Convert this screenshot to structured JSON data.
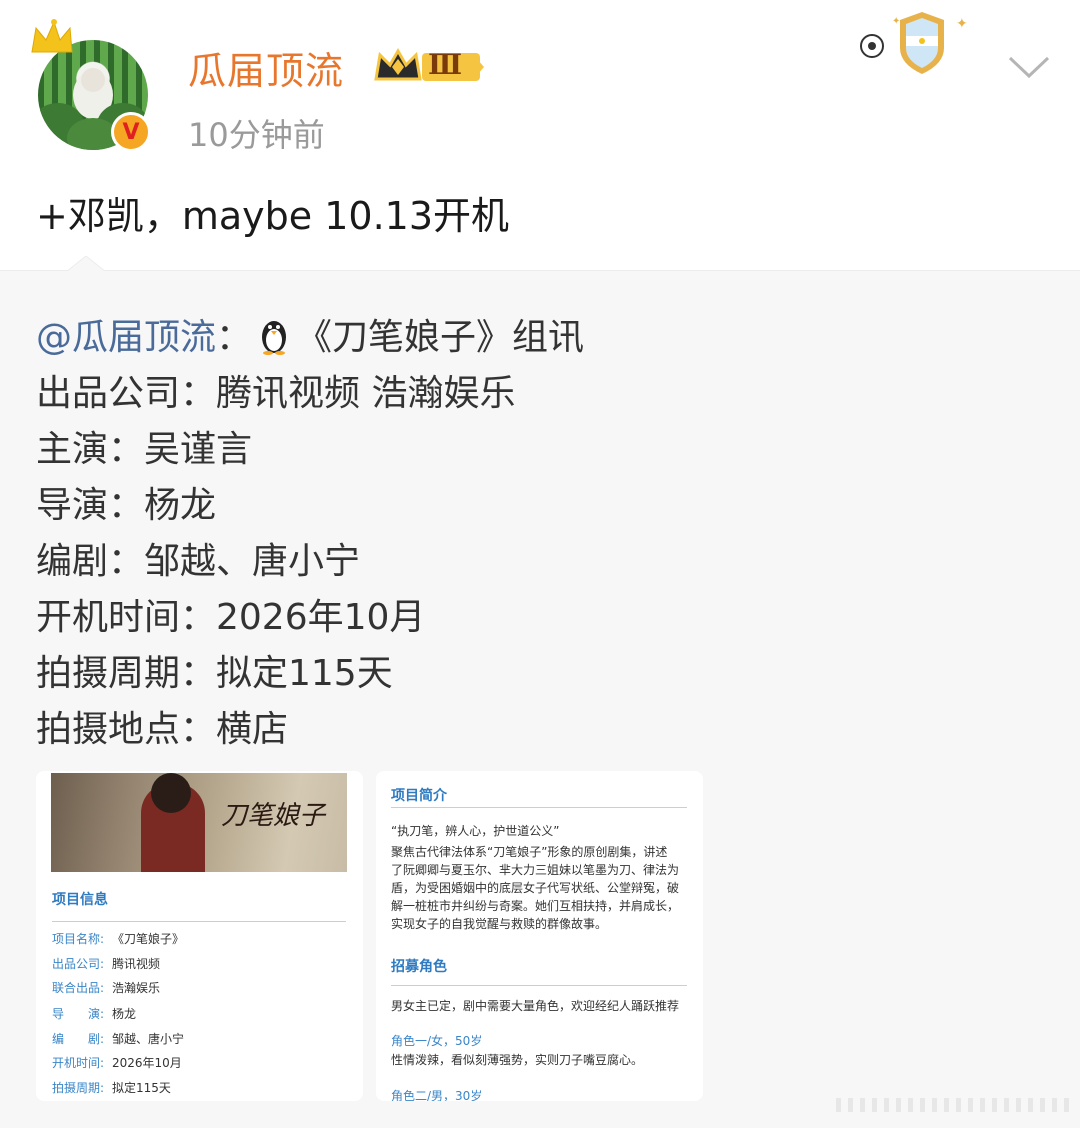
{
  "post": {
    "username": "瓜届顶流",
    "level_badge": "Ⅲ",
    "time": "10分钟前",
    "verified_mark": "V",
    "text": "+邓凯，maybe 10.13开机"
  },
  "repost": {
    "mention": "@瓜届顶流",
    "colon": "：",
    "headline": "《刀笔娘子》组讯",
    "lines": [
      "出品公司：腾讯视频 浩瀚娱乐",
      "主演：吴谨言",
      "导演：杨龙",
      "编剧：邹越、唐小宁",
      "开机时间：2026年10月",
      "拍摄周期：拟定115天",
      "拍摄地点：横店"
    ]
  },
  "card1": {
    "poster_title": "刀笔娘子",
    "section_title": "项目信息",
    "rows": [
      {
        "k": "项目名称:",
        "v": "《刀笔娘子》"
      },
      {
        "k": "出品公司:",
        "v": "腾讯视频"
      },
      {
        "k": "联合出品:",
        "v": "浩瀚娱乐"
      },
      {
        "k": "导　　演:",
        "v": "杨龙"
      },
      {
        "k": "编　　剧:",
        "v": "邹越、唐小宁"
      },
      {
        "k": "开机时间:",
        "v": "2026年10月"
      },
      {
        "k": "拍摄周期:",
        "v": "拟定115天"
      }
    ]
  },
  "card2": {
    "section_title": "项目简介",
    "intro_quote": "“执刀笔，辨人心，护世道公义”",
    "intro_lines": [
      "聚焦古代律法体系“刀笔娘子”形象的原创剧集，讲述",
      "了阮卿卿与夏玉尔、芈大力三姐妹以笔墨为刀、律法为",
      "盾，为受困婚姻中的底层女子代写状纸、公堂辩冤，破",
      "解一桩桩市井纠纷与奇案。她们互相扶持，并肩成长，",
      "实现女子的自我觉醒与救赎的群像故事。"
    ],
    "roles_title": "招募角色",
    "roles_note": "男女主已定，剧中需要大量角色，欢迎经纪人踊跃推荐",
    "role1_head": "角色一/女，50岁",
    "role1_desc": "性情泼辣，看似刻薄强势，实则刀子嘴豆腐心。",
    "role2_head": "角色二/男，30岁"
  }
}
